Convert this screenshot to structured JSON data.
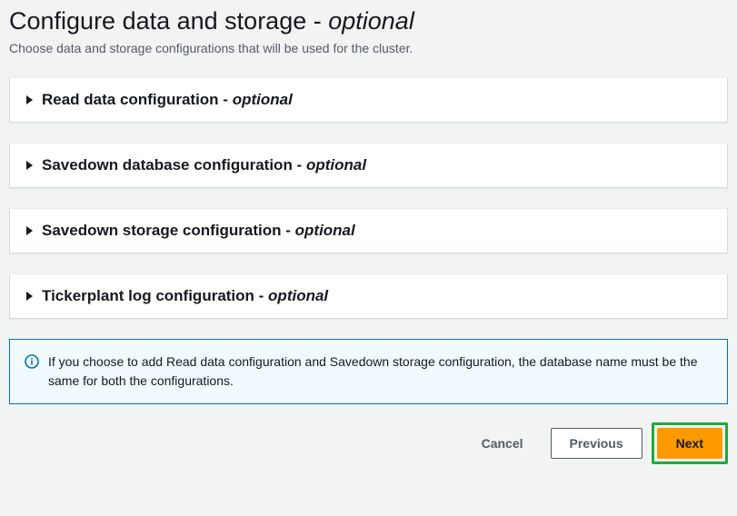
{
  "header": {
    "title_main": "Configure data and storage - ",
    "title_suffix": "optional",
    "subtext": "Choose data and storage configurations that will be used for the cluster."
  },
  "panels": [
    {
      "title_main": "Read data configuration - ",
      "title_suffix": "optional"
    },
    {
      "title_main": "Savedown database configuration - ",
      "title_suffix": "optional"
    },
    {
      "title_main": "Savedown storage configuration - ",
      "title_suffix": "optional"
    },
    {
      "title_main": "Tickerplant log configuration - ",
      "title_suffix": "optional"
    }
  ],
  "info": {
    "text": "If you choose to add Read data configuration and Savedown storage configuration, the database name must be the same for both the configurations."
  },
  "buttons": {
    "cancel": "Cancel",
    "previous": "Previous",
    "next": "Next"
  }
}
